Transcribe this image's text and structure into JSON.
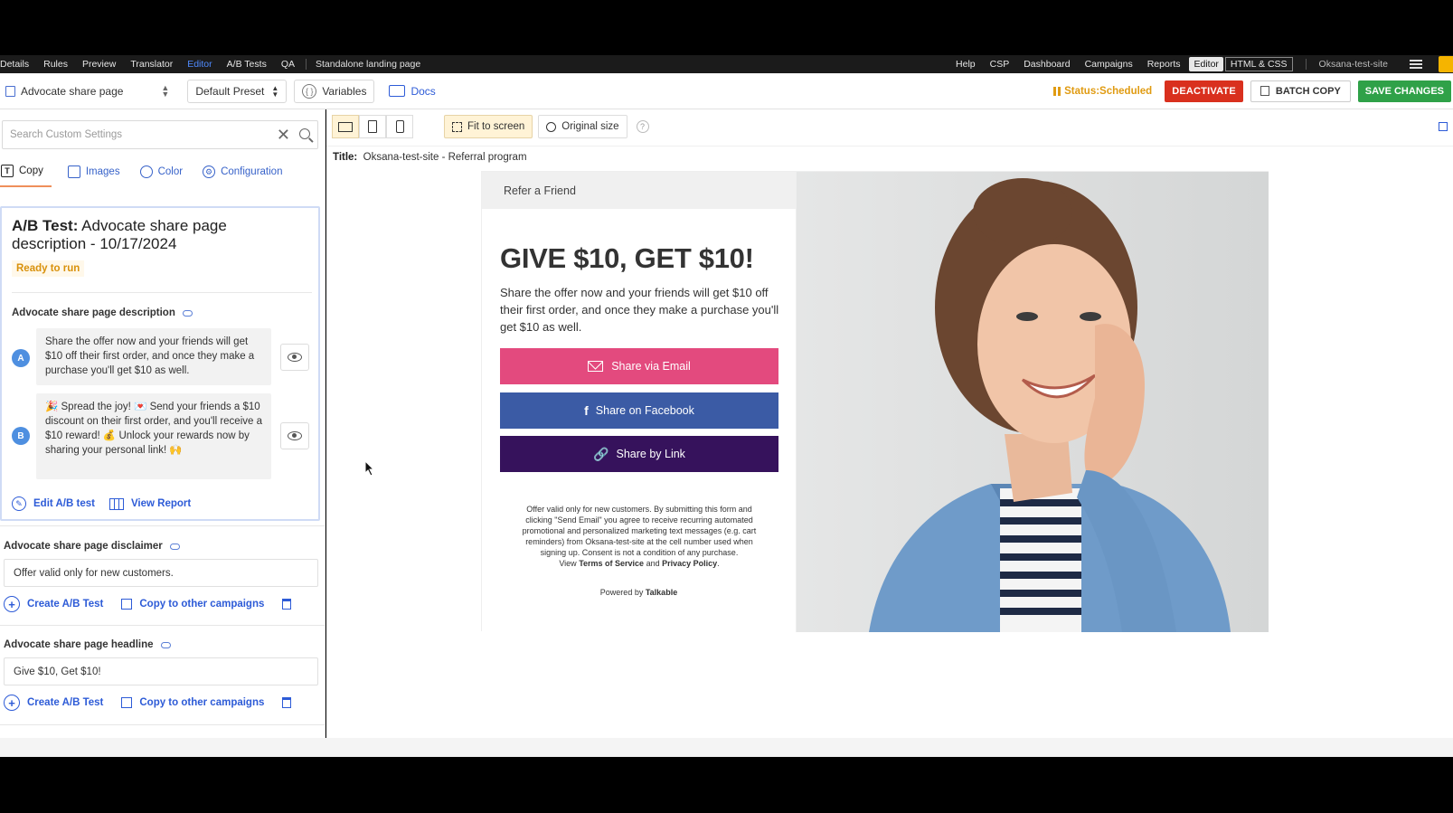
{
  "topnav": {
    "left_items": [
      "Details",
      "Rules",
      "Preview",
      "Translator",
      "Editor",
      "A/B Tests",
      "QA"
    ],
    "active": "Editor",
    "page_label": "Standalone landing page",
    "right_items": [
      "Help",
      "CSP",
      "Dashboard",
      "Campaigns",
      "Reports"
    ],
    "editor_toggle": "Editor",
    "htmlcss_toggle": "HTML & CSS",
    "site": "Oksana-test-site"
  },
  "toolbar": {
    "page_select": "Advocate share page",
    "preset_select": "Default Preset",
    "variables": "Variables",
    "docs": "Docs",
    "status": "Status:Scheduled",
    "deactivate": "DEACTIVATE",
    "batch_copy": "BATCH COPY",
    "save": "SAVE CHANGES"
  },
  "left": {
    "search_placeholder": "Search Custom Settings",
    "tabs": [
      "Copy",
      "Images",
      "Color",
      "Configuration"
    ],
    "ab": {
      "title_bold": "A/B Test:",
      "title_rest": "Advocate share page description - 10/17/2024",
      "status": "Ready to run",
      "field_label": "Advocate share page description",
      "variant_a_letter": "A",
      "variant_a": "Share the offer now and your friends will get $10 off their first order, and once they make a purchase you'll get $10 as well.",
      "variant_b_letter": "B",
      "variant_b": "🎉 Spread the joy! 💌 Send your friends a $10 discount on their first order, and you'll receive a $10 reward! 💰 Unlock your rewards now by sharing your personal link! 🙌",
      "edit": "Edit A/B test",
      "report": "View Report"
    },
    "disclaimer": {
      "label": "Advocate share page disclaimer",
      "value": "Offer valid only for new customers.",
      "create": "Create A/B Test",
      "copy": "Copy to other campaigns"
    },
    "headline": {
      "label": "Advocate share page headline",
      "value": "Give $10, Get $10!",
      "create": "Create A/B Test",
      "copy": "Copy to other campaigns"
    }
  },
  "preview": {
    "fit": "Fit to screen",
    "original": "Original size",
    "title_label": "Title:",
    "title_value": "Oksana-test-site - Referral program",
    "lp": {
      "refer": "Refer a Friend",
      "headline": "GIVE $10, GET $10!",
      "description": "Share the offer now and your friends will get $10 off their first order, and once they make a purchase you'll get $10 as well.",
      "btn_email": "Share via Email",
      "btn_facebook": "Share on Facebook",
      "btn_link": "Share by Link",
      "fine_print": "Offer valid only for new customers. By submitting this form and clicking \"Send Email\" you agree to receive recurring automated promotional and personalized marketing text messages (e.g. cart reminders) from Oksana-test-site at the cell number used when signing up. Consent is not a condition of any purchase.",
      "view": "View",
      "terms": "Terms of Service",
      "and": "and",
      "privacy": "Privacy Policy",
      "powered_by": "Powered by",
      "talkable": "Talkable",
      "colors": {
        "email": "#e34a7e",
        "facebook": "#3b5ba5",
        "link": "#36125c"
      }
    }
  }
}
